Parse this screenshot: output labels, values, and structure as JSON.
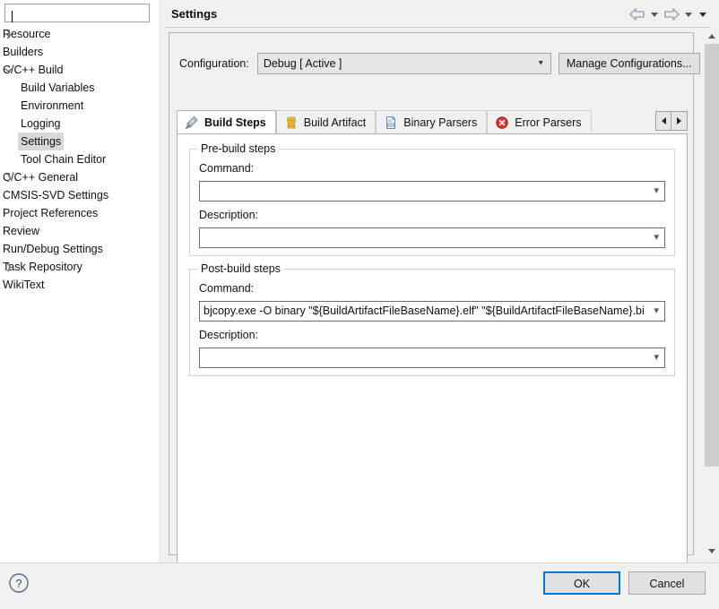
{
  "filter": {
    "value": "",
    "placeholder": ""
  },
  "tree": {
    "items": [
      {
        "label": "Resource",
        "depth": 0,
        "twisty": "collapsed",
        "selected": false
      },
      {
        "label": "Builders",
        "depth": 0,
        "twisty": "none",
        "selected": false
      },
      {
        "label": "C/C++ Build",
        "depth": 0,
        "twisty": "expanded",
        "selected": false
      },
      {
        "label": "Build Variables",
        "depth": 1,
        "twisty": "none",
        "selected": false
      },
      {
        "label": "Environment",
        "depth": 1,
        "twisty": "none",
        "selected": false
      },
      {
        "label": "Logging",
        "depth": 1,
        "twisty": "none",
        "selected": false
      },
      {
        "label": "Settings",
        "depth": 1,
        "twisty": "none",
        "selected": true
      },
      {
        "label": "Tool Chain Editor",
        "depth": 1,
        "twisty": "none",
        "selected": false
      },
      {
        "label": "C/C++ General",
        "depth": 0,
        "twisty": "collapsed",
        "selected": false
      },
      {
        "label": "CMSIS-SVD Settings",
        "depth": 0,
        "twisty": "none",
        "selected": false
      },
      {
        "label": "Project References",
        "depth": 0,
        "twisty": "none",
        "selected": false
      },
      {
        "label": "Review",
        "depth": 0,
        "twisty": "none",
        "selected": false
      },
      {
        "label": "Run/Debug Settings",
        "depth": 0,
        "twisty": "none",
        "selected": false
      },
      {
        "label": "Task Repository",
        "depth": 0,
        "twisty": "collapsed",
        "selected": false
      },
      {
        "label": "WikiText",
        "depth": 0,
        "twisty": "none",
        "selected": false
      }
    ]
  },
  "header": {
    "title": "Settings",
    "back_icon": "back-arrow-icon",
    "back_menu_icon": "chevron-down-icon",
    "forward_icon": "forward-arrow-icon",
    "forward_menu_icon": "chevron-down-icon",
    "view_menu_icon": "chevron-down-icon"
  },
  "configuration": {
    "label": "Configuration:",
    "selected": "Debug  [ Active ]",
    "options": [
      "Debug  [ Active ]"
    ],
    "manage_button": "Manage Configurations..."
  },
  "tabs": {
    "items": [
      {
        "label": "Build Steps",
        "icon": "build-steps-icon",
        "active": true
      },
      {
        "label": "Build Artifact",
        "icon": "build-artifact-icon",
        "active": false
      },
      {
        "label": "Binary Parsers",
        "icon": "binary-parsers-icon",
        "active": false
      },
      {
        "label": "Error Parsers",
        "icon": "error-parsers-icon",
        "active": false
      }
    ],
    "scroll_left_icon": "triangle-left-icon",
    "scroll_right_icon": "triangle-right-icon"
  },
  "prebuild": {
    "group_title": "Pre-build steps",
    "command_label": "Command:",
    "command_value": "",
    "description_label": "Description:",
    "description_value": ""
  },
  "postbuild": {
    "group_title": "Post-build steps",
    "command_label": "Command:",
    "command_value": "bjcopy.exe -O binary \"${BuildArtifactFileBaseName}.elf\" \"${BuildArtifactFileBaseName}.bin\"",
    "description_label": "Description:",
    "description_value": ""
  },
  "footer": {
    "help_icon": "help-question-icon",
    "ok": "OK",
    "cancel": "Cancel"
  },
  "colors": {
    "accent": "#0078d7",
    "selection": "#d8d8d8",
    "dialog_bg": "#f0f0f0",
    "error_icon": "#d32f2f",
    "artifact_icon": "#f0a830"
  }
}
